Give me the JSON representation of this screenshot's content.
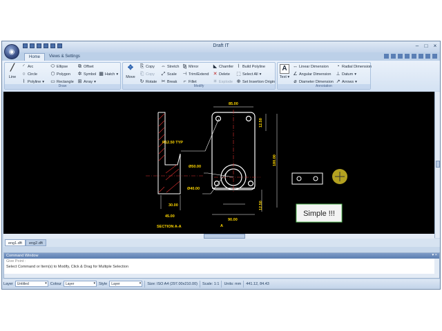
{
  "window": {
    "title": "Draft IT"
  },
  "ribbon_tabs": [
    "Home",
    "Views & Settings"
  ],
  "groups": {
    "draw": {
      "label": "Draw",
      "line": "Line",
      "items": [
        [
          "Arc",
          "Ellipse",
          "Offset"
        ],
        [
          "Circle",
          "Polygon",
          "Symbol"
        ],
        [
          "Polyline",
          "Rectangle",
          "Array"
        ]
      ],
      "hatch": "Hatch"
    },
    "modify": {
      "label": "Modify",
      "move": "Move",
      "items": [
        [
          "Copy",
          "Stretch",
          "Mirror",
          "Chamfer",
          "Build Polyline"
        ],
        [
          "Copy",
          "Scale",
          "Trim/Extend",
          "Delete",
          "Select All"
        ],
        [
          "Rotate",
          "Break",
          "Fillet",
          "Explode",
          "Set Insertion Origin"
        ]
      ]
    },
    "annotation": {
      "label": "Annotation",
      "text": "Text",
      "items": [
        [
          "Linear Dimension",
          "Radial Dimension"
        ],
        [
          "Angular Dimension",
          "Datum"
        ],
        [
          "Diameter Dimension",
          "Arrows"
        ]
      ]
    }
  },
  "drawing": {
    "r_typ": "R12.50 TYP",
    "dia50": "Ø50.00",
    "dia40": "Ø40.00",
    "top": "85.00",
    "h1": "12.50",
    "h2": "180.00",
    "h3": "12.50",
    "bottom": "90.00",
    "left1": "30.00",
    "left2": "45.00",
    "section": "SECTION A-A",
    "a_label": "A",
    "bubble": "Simple !!!"
  },
  "doc_tabs": [
    "eng1.dft",
    "eng2.dft"
  ],
  "command": {
    "title": "Command Window",
    "line1": "Give Point :",
    "line2": "Select Command or Item(s) to Modify, Click & Drag for Multiple Selection"
  },
  "status": {
    "layer_label": "Layer",
    "layer_value": "Untitled",
    "colour_label": "Colour",
    "colour_value": "Layer",
    "style_label": "Style",
    "style_value": "Layer",
    "size": "Size: ISO A4 (297.00x210.00)",
    "scale": "Scale: 1:1",
    "units": "Units: mm",
    "coords": "441.12, 84.43"
  }
}
